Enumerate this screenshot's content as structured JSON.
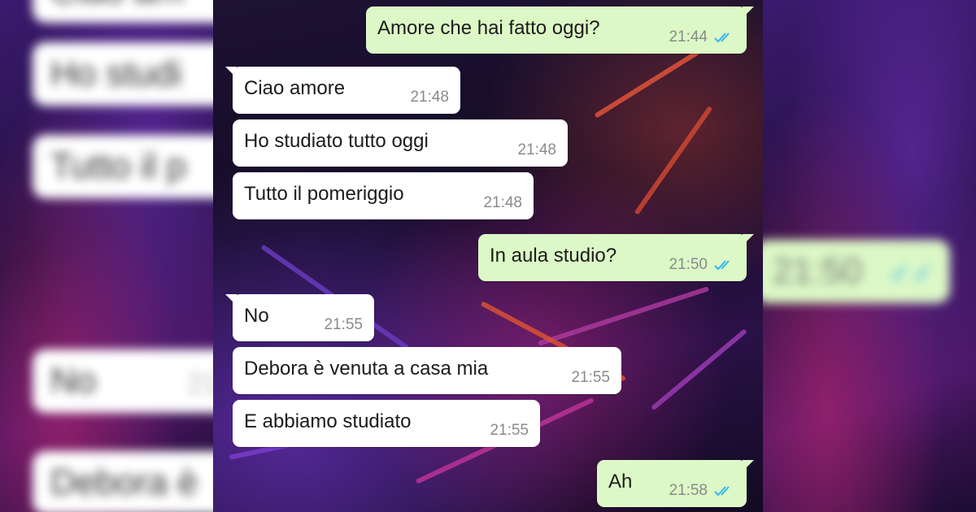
{
  "colors": {
    "incoming_bubble": "#ffffff",
    "outgoing_bubble": "#dcf8c6",
    "read_ticks": "#34b7f1",
    "timestamp": "#8a8a8a"
  },
  "chat": {
    "messages": [
      {
        "direction": "outgoing",
        "text": "Amore che hai fatto oggi?",
        "time": "21:44",
        "status": "read"
      },
      {
        "direction": "incoming",
        "text": "Ciao amore",
        "time": "21:48"
      },
      {
        "direction": "incoming",
        "text": "Ho studiato tutto oggi",
        "time": "21:48"
      },
      {
        "direction": "incoming",
        "text": "Tutto il pomeriggio",
        "time": "21:48"
      },
      {
        "direction": "outgoing",
        "text": "In aula studio?",
        "time": "21:50",
        "status": "read"
      },
      {
        "direction": "incoming",
        "text": "No",
        "time": "21:55"
      },
      {
        "direction": "incoming",
        "text": "Debora è venuta a casa mia",
        "time": "21:55"
      },
      {
        "direction": "incoming",
        "text": "E abbiamo studiato",
        "time": "21:55"
      },
      {
        "direction": "outgoing",
        "text": "Ah",
        "time": "21:58",
        "status": "read"
      }
    ]
  },
  "blurred_left": {
    "items": [
      {
        "text": "Ciao am"
      },
      {
        "text": "Ho studi"
      },
      {
        "text": "Tutto il p"
      },
      {
        "text": "No",
        "time": "21"
      },
      {
        "text": "Debora è"
      }
    ]
  },
  "blurred_right": {
    "items": [
      {
        "time": "21:50",
        "status": "read"
      }
    ]
  }
}
